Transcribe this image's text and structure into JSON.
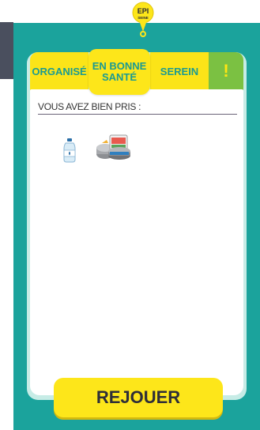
{
  "logo": {
    "text_top": "EPI",
    "text_bottom": "SEINE"
  },
  "tabs": [
    {
      "label": "ORGANISÉ"
    },
    {
      "label": "EN BONNE SANTÉ",
      "line1": "EN BONNE",
      "line2": "SANTÉ",
      "active": true
    },
    {
      "label": "SEREIN"
    },
    {
      "label": "!"
    }
  ],
  "card": {
    "heading": "VOUS AVEZ BIEN PRIS :",
    "items": [
      {
        "icon": "water-bottle-icon"
      },
      {
        "icon": "canned-food-icon"
      }
    ]
  },
  "replay_button": {
    "label": "REJOUER"
  },
  "colors": {
    "panel": "#1ba39c",
    "tab_yellow": "#fbe418",
    "tab_green": "#7bc142",
    "button_yellow": "#fde61a"
  }
}
